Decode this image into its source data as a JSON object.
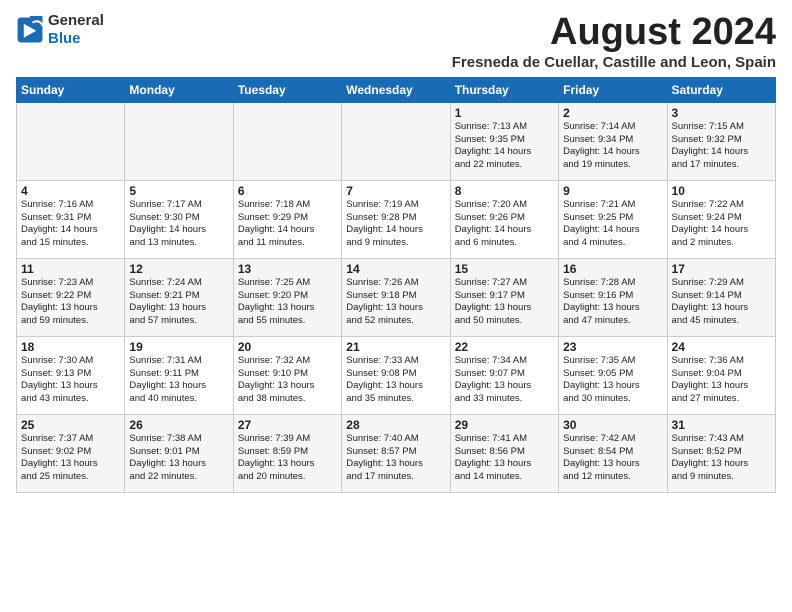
{
  "header": {
    "logo_line1": "General",
    "logo_line2": "Blue",
    "title": "August 2024",
    "subtitle": "Fresneda de Cuellar, Castille and Leon, Spain"
  },
  "days_of_week": [
    "Sunday",
    "Monday",
    "Tuesday",
    "Wednesday",
    "Thursday",
    "Friday",
    "Saturday"
  ],
  "weeks": [
    [
      {
        "day": "",
        "text": ""
      },
      {
        "day": "",
        "text": ""
      },
      {
        "day": "",
        "text": ""
      },
      {
        "day": "",
        "text": ""
      },
      {
        "day": "1",
        "text": "Sunrise: 7:13 AM\nSunset: 9:35 PM\nDaylight: 14 hours\nand 22 minutes."
      },
      {
        "day": "2",
        "text": "Sunrise: 7:14 AM\nSunset: 9:34 PM\nDaylight: 14 hours\nand 19 minutes."
      },
      {
        "day": "3",
        "text": "Sunrise: 7:15 AM\nSunset: 9:32 PM\nDaylight: 14 hours\nand 17 minutes."
      }
    ],
    [
      {
        "day": "4",
        "text": "Sunrise: 7:16 AM\nSunset: 9:31 PM\nDaylight: 14 hours\nand 15 minutes."
      },
      {
        "day": "5",
        "text": "Sunrise: 7:17 AM\nSunset: 9:30 PM\nDaylight: 14 hours\nand 13 minutes."
      },
      {
        "day": "6",
        "text": "Sunrise: 7:18 AM\nSunset: 9:29 PM\nDaylight: 14 hours\nand 11 minutes."
      },
      {
        "day": "7",
        "text": "Sunrise: 7:19 AM\nSunset: 9:28 PM\nDaylight: 14 hours\nand 9 minutes."
      },
      {
        "day": "8",
        "text": "Sunrise: 7:20 AM\nSunset: 9:26 PM\nDaylight: 14 hours\nand 6 minutes."
      },
      {
        "day": "9",
        "text": "Sunrise: 7:21 AM\nSunset: 9:25 PM\nDaylight: 14 hours\nand 4 minutes."
      },
      {
        "day": "10",
        "text": "Sunrise: 7:22 AM\nSunset: 9:24 PM\nDaylight: 14 hours\nand 2 minutes."
      }
    ],
    [
      {
        "day": "11",
        "text": "Sunrise: 7:23 AM\nSunset: 9:22 PM\nDaylight: 13 hours\nand 59 minutes."
      },
      {
        "day": "12",
        "text": "Sunrise: 7:24 AM\nSunset: 9:21 PM\nDaylight: 13 hours\nand 57 minutes."
      },
      {
        "day": "13",
        "text": "Sunrise: 7:25 AM\nSunset: 9:20 PM\nDaylight: 13 hours\nand 55 minutes."
      },
      {
        "day": "14",
        "text": "Sunrise: 7:26 AM\nSunset: 9:18 PM\nDaylight: 13 hours\nand 52 minutes."
      },
      {
        "day": "15",
        "text": "Sunrise: 7:27 AM\nSunset: 9:17 PM\nDaylight: 13 hours\nand 50 minutes."
      },
      {
        "day": "16",
        "text": "Sunrise: 7:28 AM\nSunset: 9:16 PM\nDaylight: 13 hours\nand 47 minutes."
      },
      {
        "day": "17",
        "text": "Sunrise: 7:29 AM\nSunset: 9:14 PM\nDaylight: 13 hours\nand 45 minutes."
      }
    ],
    [
      {
        "day": "18",
        "text": "Sunrise: 7:30 AM\nSunset: 9:13 PM\nDaylight: 13 hours\nand 43 minutes."
      },
      {
        "day": "19",
        "text": "Sunrise: 7:31 AM\nSunset: 9:11 PM\nDaylight: 13 hours\nand 40 minutes."
      },
      {
        "day": "20",
        "text": "Sunrise: 7:32 AM\nSunset: 9:10 PM\nDaylight: 13 hours\nand 38 minutes."
      },
      {
        "day": "21",
        "text": "Sunrise: 7:33 AM\nSunset: 9:08 PM\nDaylight: 13 hours\nand 35 minutes."
      },
      {
        "day": "22",
        "text": "Sunrise: 7:34 AM\nSunset: 9:07 PM\nDaylight: 13 hours\nand 33 minutes."
      },
      {
        "day": "23",
        "text": "Sunrise: 7:35 AM\nSunset: 9:05 PM\nDaylight: 13 hours\nand 30 minutes."
      },
      {
        "day": "24",
        "text": "Sunrise: 7:36 AM\nSunset: 9:04 PM\nDaylight: 13 hours\nand 27 minutes."
      }
    ],
    [
      {
        "day": "25",
        "text": "Sunrise: 7:37 AM\nSunset: 9:02 PM\nDaylight: 13 hours\nand 25 minutes."
      },
      {
        "day": "26",
        "text": "Sunrise: 7:38 AM\nSunset: 9:01 PM\nDaylight: 13 hours\nand 22 minutes."
      },
      {
        "day": "27",
        "text": "Sunrise: 7:39 AM\nSunset: 8:59 PM\nDaylight: 13 hours\nand 20 minutes."
      },
      {
        "day": "28",
        "text": "Sunrise: 7:40 AM\nSunset: 8:57 PM\nDaylight: 13 hours\nand 17 minutes."
      },
      {
        "day": "29",
        "text": "Sunrise: 7:41 AM\nSunset: 8:56 PM\nDaylight: 13 hours\nand 14 minutes."
      },
      {
        "day": "30",
        "text": "Sunrise: 7:42 AM\nSunset: 8:54 PM\nDaylight: 13 hours\nand 12 minutes."
      },
      {
        "day": "31",
        "text": "Sunrise: 7:43 AM\nSunset: 8:52 PM\nDaylight: 13 hours\nand 9 minutes."
      }
    ]
  ]
}
